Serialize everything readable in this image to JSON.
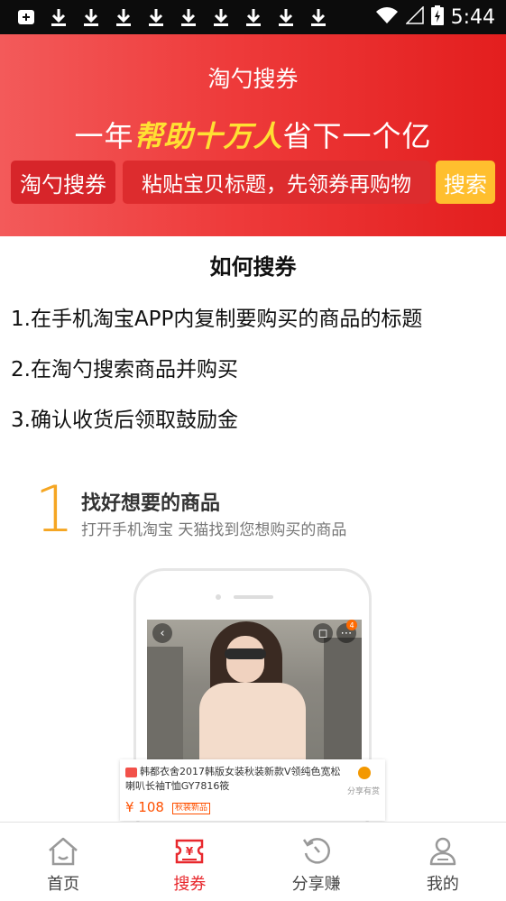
{
  "status_bar": {
    "time": "5:44",
    "icons": [
      "app-notification-icon",
      "download-icon",
      "download-icon",
      "download-icon",
      "download-icon",
      "download-icon",
      "download-icon",
      "download-icon",
      "download-icon",
      "download-icon"
    ]
  },
  "hero": {
    "title": "淘勺搜券",
    "slogan_pre": "一年",
    "slogan_highlight": "帮助十万人",
    "slogan_post": "省下一个亿",
    "brand_chip": "淘勺搜券",
    "search_placeholder": "粘贴宝贝标题，先领券再购物",
    "search_button": "搜索",
    "colors": {
      "hero_red": "#e31e1e",
      "highlight": "#ffe033",
      "search_button": "#ffbf2e"
    }
  },
  "howto": {
    "title": "如何搜券",
    "steps": [
      "1.在手机淘宝APP内复制要购买的商品的标题",
      "2.在淘勺搜索商品并购买",
      "3.确认收货后领取鼓励金"
    ]
  },
  "guide": {
    "number": "1",
    "title": "找好想要的商品",
    "subtitle": "打开手机淘宝 天猫找到您想购买的商品",
    "badge_count": "4",
    "product_title": "韩都衣舍2017韩版女装秋装新款V领纯色宽松喇叭长袖T恤GY7816筱",
    "product_price": "¥ 108",
    "product_tag": "秋装新品",
    "share_label": "分享有赏"
  },
  "tabbar": {
    "active_color": "#e8282d",
    "tabs": [
      {
        "label": "首页",
        "icon": "home-icon"
      },
      {
        "label": "搜券",
        "icon": "coupon-icon"
      },
      {
        "label": "分享赚",
        "icon": "share-refresh-icon"
      },
      {
        "label": "我的",
        "icon": "profile-icon"
      }
    ]
  }
}
